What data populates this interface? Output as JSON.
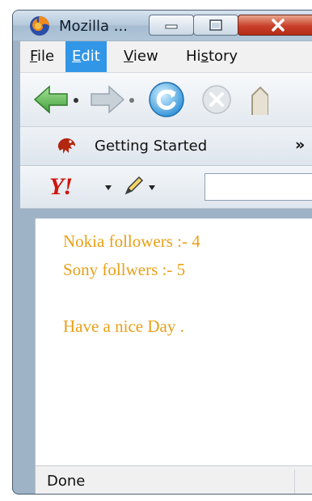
{
  "window": {
    "title": "Mozilla ..."
  },
  "menubar": {
    "items": [
      {
        "label": "File",
        "underline": "F",
        "rest": "ile"
      },
      {
        "label": "Edit",
        "underline": "E",
        "rest": "dit"
      },
      {
        "label": "View",
        "underline": "V",
        "rest": "iew"
      },
      {
        "label": "History",
        "pre": "Hi",
        "underline": "s",
        "rest": "tory"
      }
    ],
    "active": "Edit"
  },
  "navbar": {
    "icons": [
      "back-arrow-icon",
      "forward-arrow-icon",
      "reload-icon",
      "stop-icon"
    ]
  },
  "bookmarks": {
    "item_label": "Getting Started",
    "more": "»"
  },
  "searchbar": {
    "logo": "Y!",
    "input_value": ""
  },
  "content": {
    "lines": [
      "Nokia followers :- 4",
      "Sony follwers :- 5",
      "Have a nice Day ."
    ],
    "text_color": "#e8a017"
  },
  "statusbar": {
    "text": "Done"
  }
}
